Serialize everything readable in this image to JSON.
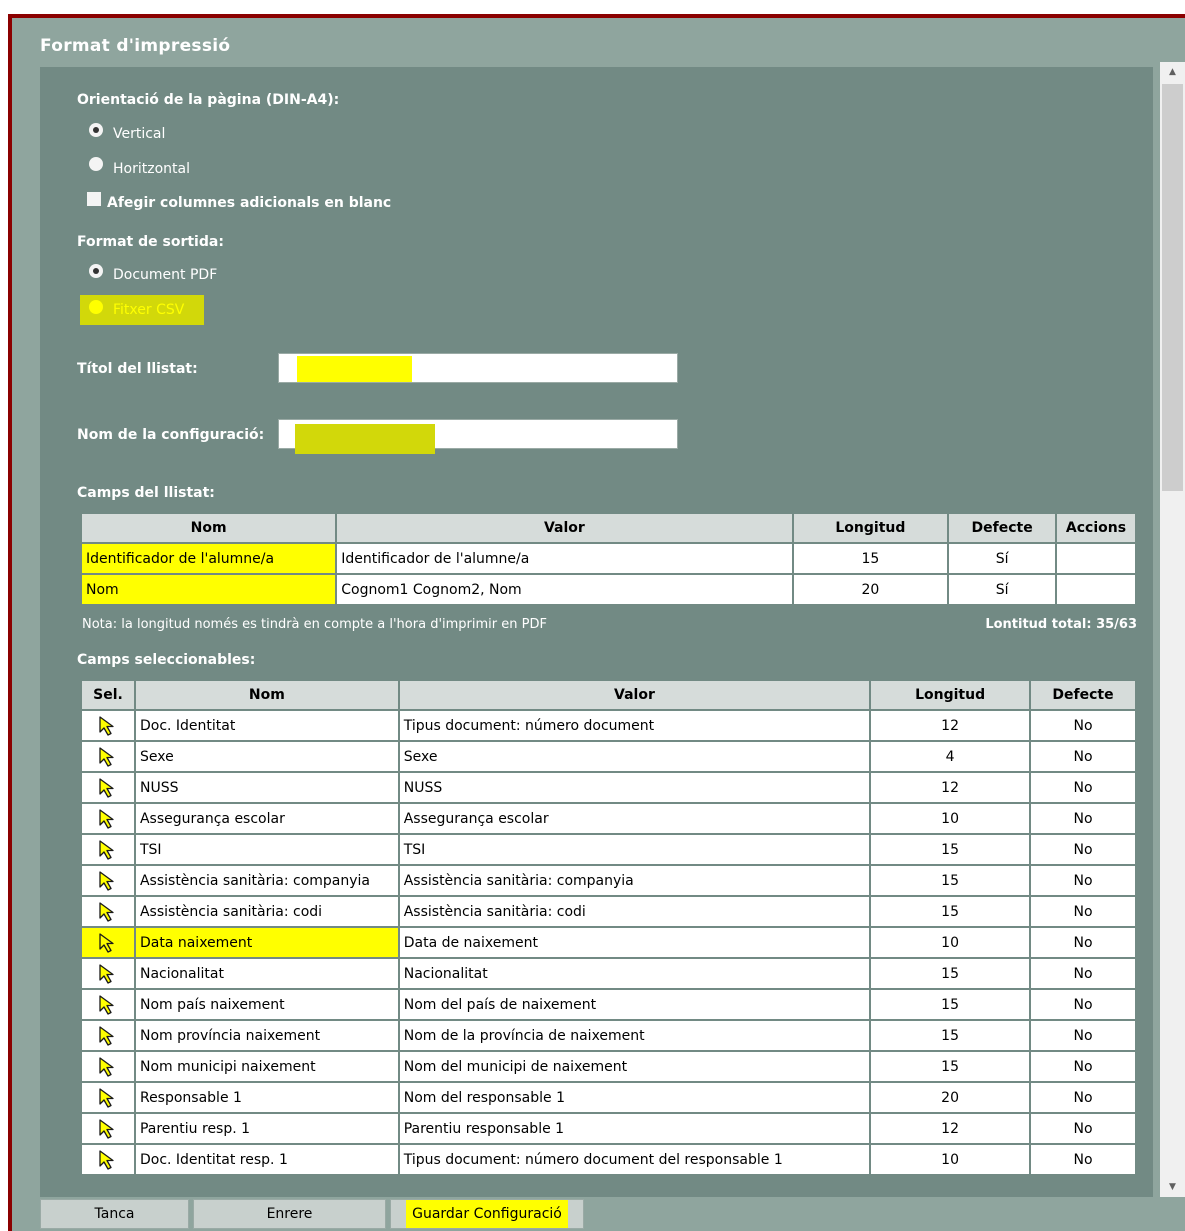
{
  "window": {
    "title": "Format d'impressió"
  },
  "orientation": {
    "label": "Orientació de la pàgina (DIN-A4):",
    "options": [
      "Vertical",
      "Horitzontal"
    ],
    "selected": "Vertical"
  },
  "extra_columns": {
    "label": "Afegir columnes adicionals en blanc",
    "checked": false
  },
  "output_format": {
    "label": "Format de sortida:",
    "options": [
      "Document PDF",
      "Fitxer CSV"
    ],
    "selected": "Fitxer CSV"
  },
  "list_title": {
    "label": "Títol del llistat:",
    "value": ""
  },
  "config_name": {
    "label": "Nom de la configuració:",
    "value": ""
  },
  "list_fields": {
    "label": "Camps del llistat:",
    "columns": [
      "Nom",
      "Valor",
      "Longitud",
      "Defecte",
      "Accions"
    ],
    "rows": [
      [
        "Identificador de l'alumne/a",
        "Identificador de l'alumne/a",
        "15",
        "Sí",
        ""
      ],
      [
        "Nom",
        "Cognom1 Cognom2, Nom",
        "20",
        "Sí",
        ""
      ]
    ],
    "note": "Nota: la longitud només es tindrà en compte a l'hora d'imprimir en PDF",
    "total": "Lontitud total: 35/63"
  },
  "selectable_fields": {
    "label": "Camps seleccionables:",
    "columns": [
      "Sel.",
      "Nom",
      "Valor",
      "Longitud",
      "Defecte"
    ],
    "rows": [
      [
        "Doc. Identitat",
        "Tipus document: número document",
        "12",
        "No"
      ],
      [
        "Sexe",
        "Sexe",
        "4",
        "No"
      ],
      [
        "NUSS",
        "NUSS",
        "12",
        "No"
      ],
      [
        "Assegurança escolar",
        "Assegurança escolar",
        "10",
        "No"
      ],
      [
        "TSI",
        "TSI",
        "15",
        "No"
      ],
      [
        "Assistència sanitària: companyia",
        "Assistència sanitària: companyia",
        "15",
        "No"
      ],
      [
        "Assistència sanitària: codi",
        "Assistència sanitària: codi",
        "15",
        "No"
      ],
      [
        "Data naixement",
        "Data de naixement",
        "10",
        "No"
      ],
      [
        "Nacionalitat",
        "Nacionalitat",
        "15",
        "No"
      ],
      [
        "Nom país naixement",
        "Nom del país de naixement",
        "15",
        "No"
      ],
      [
        "Nom província naixement",
        "Nom de la província de naixement",
        "15",
        "No"
      ],
      [
        "Nom municipi naixement",
        "Nom del municipi de naixement",
        "15",
        "No"
      ],
      [
        "Responsable 1",
        "Nom del responsable 1",
        "20",
        "No"
      ],
      [
        "Parentiu resp. 1",
        "Parentiu responsable 1",
        "12",
        "No"
      ],
      [
        "Doc. Identitat resp. 1",
        "Tipus document: número document del responsable 1",
        "10",
        "No"
      ]
    ],
    "select_icon": "pointer-arrow-icon"
  },
  "buttons": {
    "close": "Tanca",
    "back": "Enrere",
    "save": "Guardar Configuració"
  },
  "colors": {
    "panel": "#8fa59e",
    "content": "#728a84",
    "highlight": "#ffff00",
    "frame": "#8b0000"
  }
}
